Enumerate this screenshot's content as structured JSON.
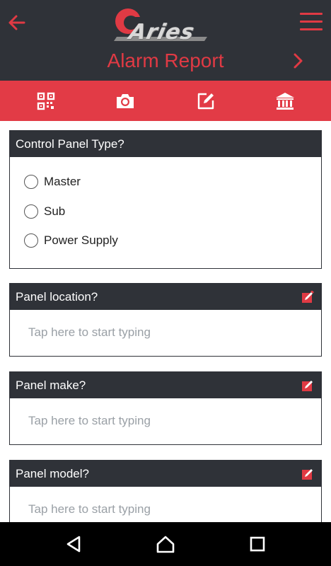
{
  "header": {
    "logo_text": "Aries",
    "title": "Alarm Report",
    "back_icon": "arrow-left-icon",
    "menu_icon": "hamburger-menu-icon",
    "next_icon": "chevron-right-icon"
  },
  "toolbar": {
    "items": [
      {
        "icon": "qr-code-icon"
      },
      {
        "icon": "camera-icon"
      },
      {
        "icon": "edit-note-icon"
      },
      {
        "icon": "bank-building-icon"
      }
    ]
  },
  "control_panel_type": {
    "question": "Control Panel Type?",
    "options": [
      "Master",
      "Sub",
      "Power Supply"
    ]
  },
  "panel_location": {
    "question": "Panel location?",
    "placeholder": "Tap here to start typing"
  },
  "panel_make": {
    "question": "Panel make?",
    "placeholder": "Tap here to start typing"
  },
  "panel_model": {
    "question": "Panel model?",
    "placeholder": "Tap here to start typing"
  },
  "colors": {
    "accent": "#e23b46",
    "dark": "#2f3238"
  }
}
